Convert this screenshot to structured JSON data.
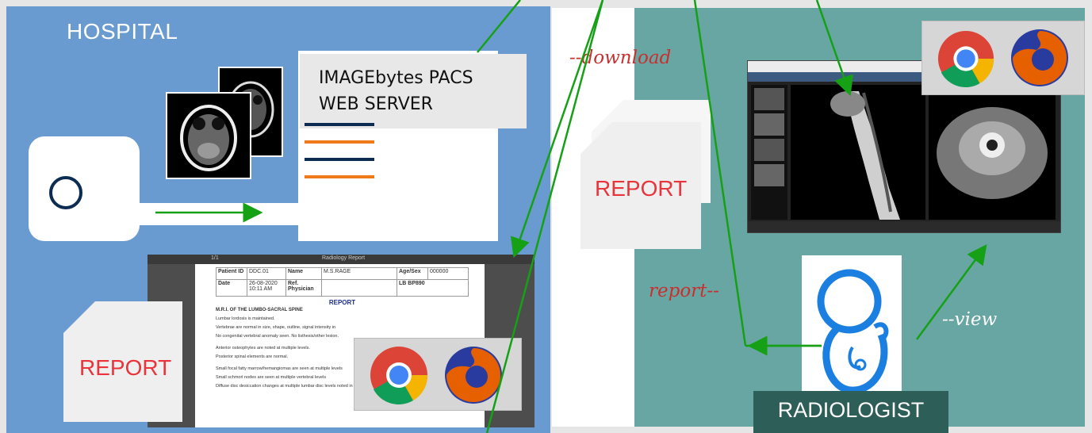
{
  "hospital": {
    "title": "HOSPITAL",
    "server_label_line1": "IMAGEbytes PACS",
    "server_label_line2": "WEB SERVER",
    "report_label": "REPORT"
  },
  "pdf_viewer": {
    "toolbar_page": "1/1",
    "toolbar_title": "Radiology Report",
    "fields": {
      "patient_id_label": "Patient ID",
      "patient_id_value": "DDC.01",
      "name_label": "Name",
      "name_value": "M.S.RAGE",
      "age_sex_label": "Age/Sex",
      "age_sex_value": "000000",
      "date_label": "Date",
      "date_value": "26-08-2020 10:11 AM",
      "ref_label": "Ref. Physician",
      "lab_label": "LB BP890"
    },
    "heading": "REPORT",
    "subheading": "M.R.I. OF THE LUMBO-SACRAL SPINE",
    "lines": [
      "Lumbar lordosis is maintained.",
      "Vertebrae are normal in size, shape, outline, signal intensity in",
      "No congenital vertebral anomaly seen. No listhesis/other lesion.",
      "Anterior osteophytes are noted at multiple levels.",
      "Posterior spinal elements are normal.",
      "Small focal fatty marrow/hemangiomas are seen at multiple levels",
      "Small schmorl nodes are seen at multiple vertebral levels",
      "Diffuse disc desiccation changes at multiple lumbar disc levels noted in the form of loss of T2W hyperintense signal intensity"
    ]
  },
  "middle": {
    "download_label": "--download",
    "report_label": "REPORT"
  },
  "radiologist": {
    "title": "RADIOLOGIST",
    "report_label": "report--",
    "view_label": "--view"
  },
  "icons": {
    "browsers": [
      "chrome-icon",
      "firefox-icon"
    ]
  },
  "colors": {
    "hospital_panel": "#6a9bd0",
    "radiologist_panel": "#67a6a2",
    "arrow_green": "#16a016",
    "report_red": "#e8343a",
    "navy": "#0d2c52",
    "orange": "#f07a1a"
  }
}
